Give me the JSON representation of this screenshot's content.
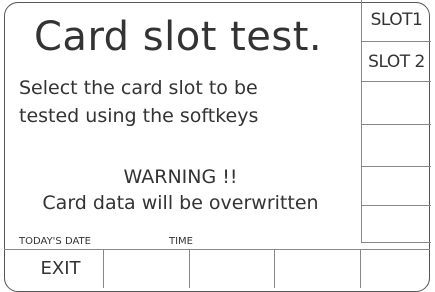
{
  "screen": {
    "title": "Card slot test.",
    "instruction_line1": "Select the card slot to be",
    "instruction_line2": "tested using the softkeys",
    "warning_line1": "WARNING !!",
    "warning_line2": "Card data will be overwritten"
  },
  "status_bar": {
    "date_label": "TODAY'S DATE",
    "time_label": "TIME"
  },
  "right_softkeys": [
    "SLOT1",
    "SLOT 2",
    "",
    "",
    "",
    ""
  ],
  "bottom_softkeys": [
    "EXIT",
    "",
    "",
    "",
    ""
  ]
}
